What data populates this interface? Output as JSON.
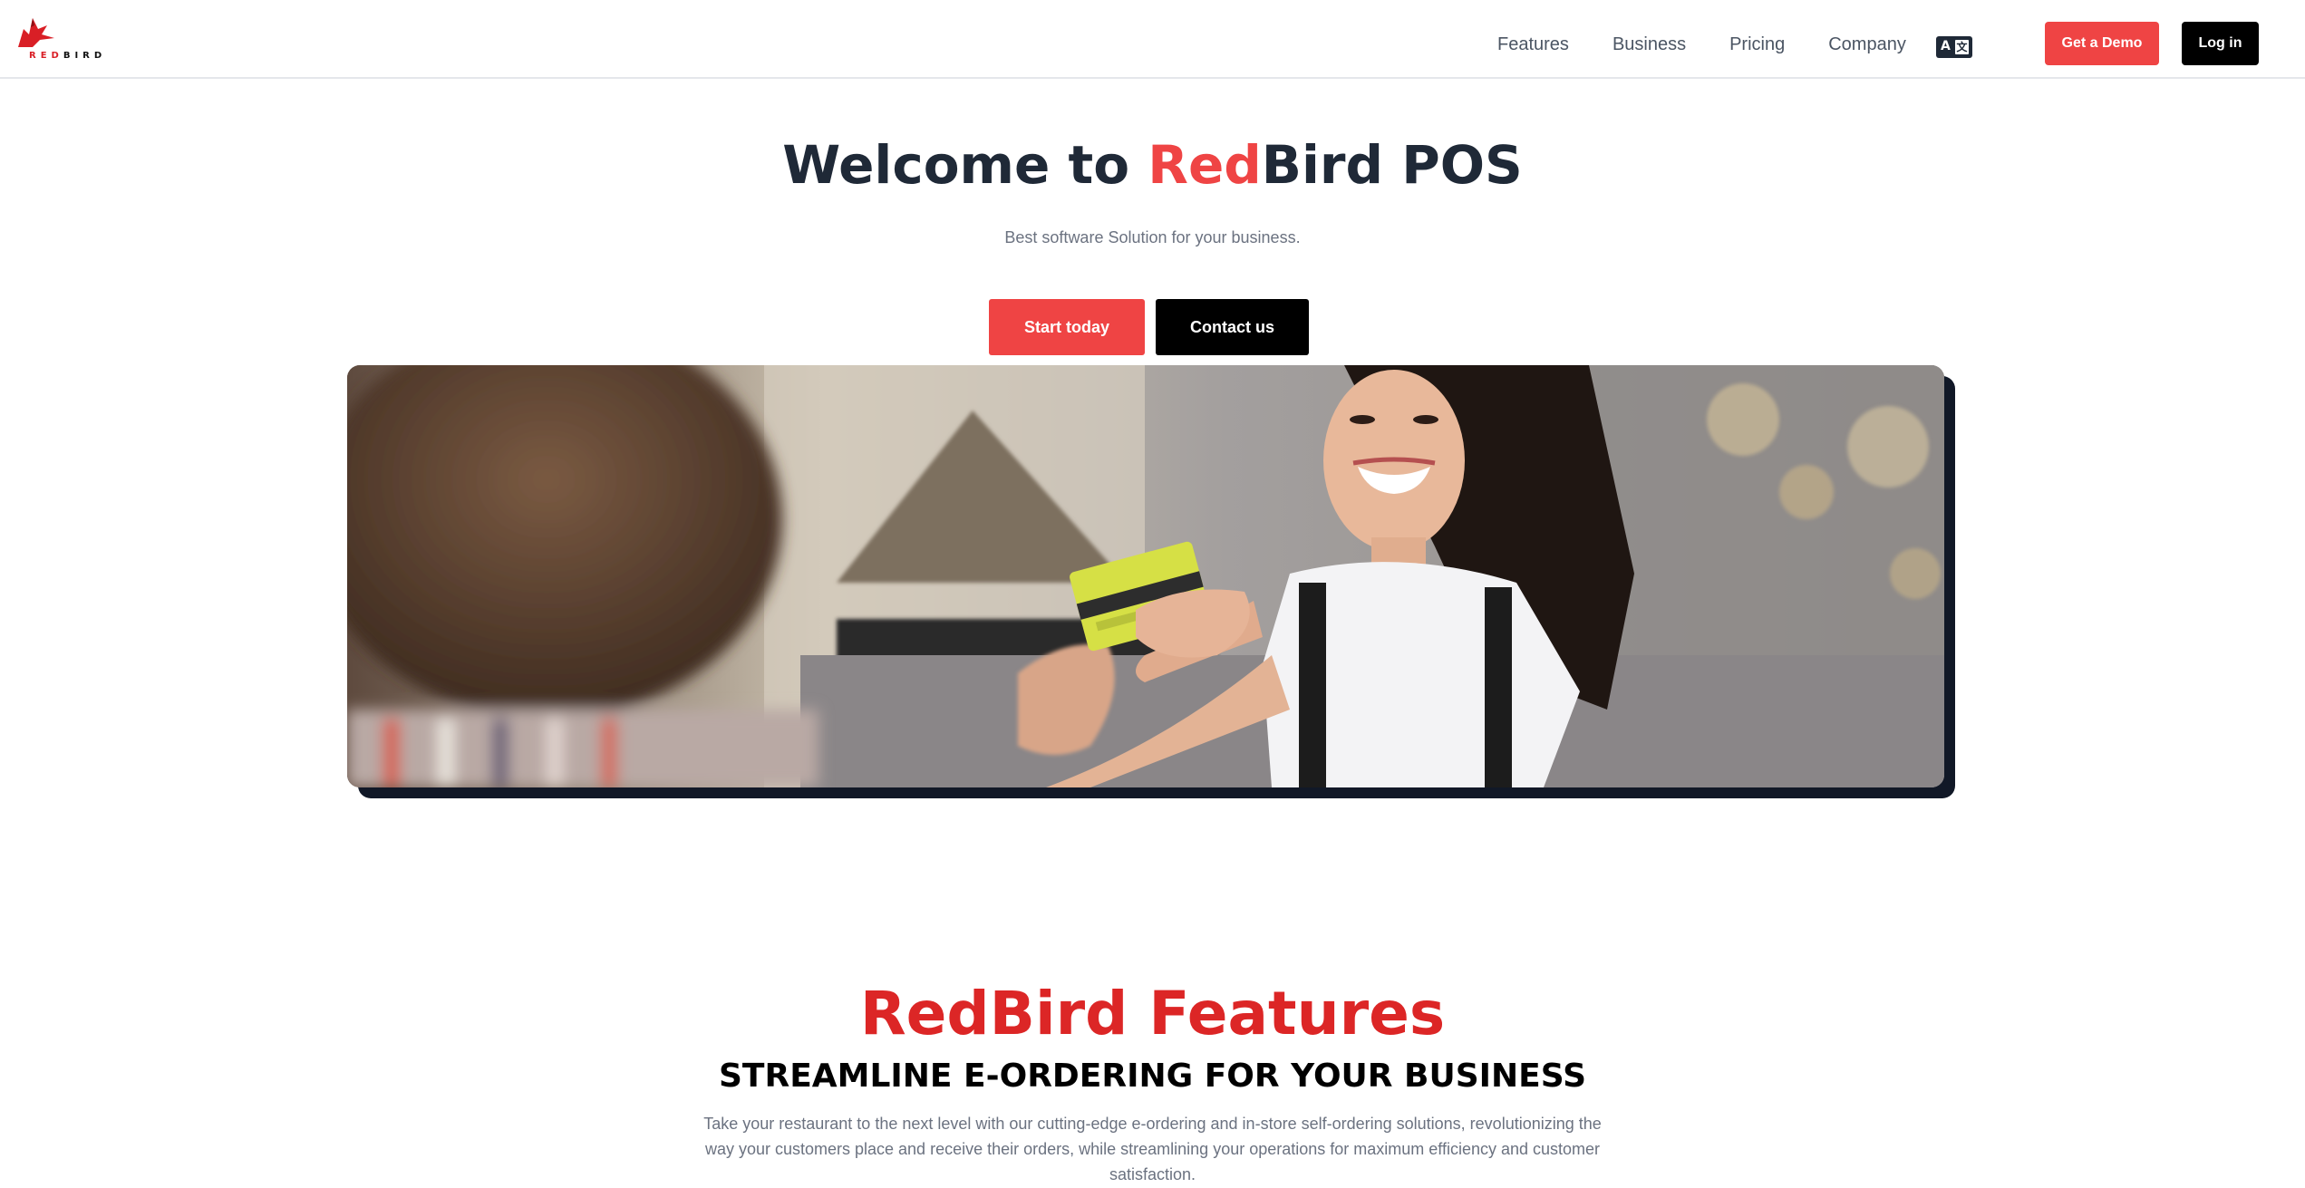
{
  "header": {
    "logo_text_red": "RED",
    "logo_text_black": "BIRD",
    "nav": [
      {
        "label": "Features"
      },
      {
        "label": "Business"
      },
      {
        "label": "Pricing"
      },
      {
        "label": "Company"
      }
    ],
    "language_icon": "translate-icon",
    "demo_label": "Get a Demo",
    "login_label": "Log in"
  },
  "hero": {
    "title_prefix": "Welcome to ",
    "title_accent": "Red",
    "title_suffix": "Bird POS",
    "subtitle": "Best software Solution for your business.",
    "start_label": "Start today",
    "contact_label": "Contact us"
  },
  "features": {
    "title": "RedBird Features",
    "subtitle": "STREAMLINE E-ORDERING FOR YOUR BUSINESS",
    "description": "Take your restaurant to the next level with our cutting-edge e-ordering and in-store self-ordering solutions, revolutionizing the way your customers place and receive their orders, while streamlining your operations for maximum efficiency and customer satisfaction."
  },
  "colors": {
    "brand_red": "#ef4444",
    "heading_red": "#dc2626",
    "dark": "#1f2937"
  }
}
